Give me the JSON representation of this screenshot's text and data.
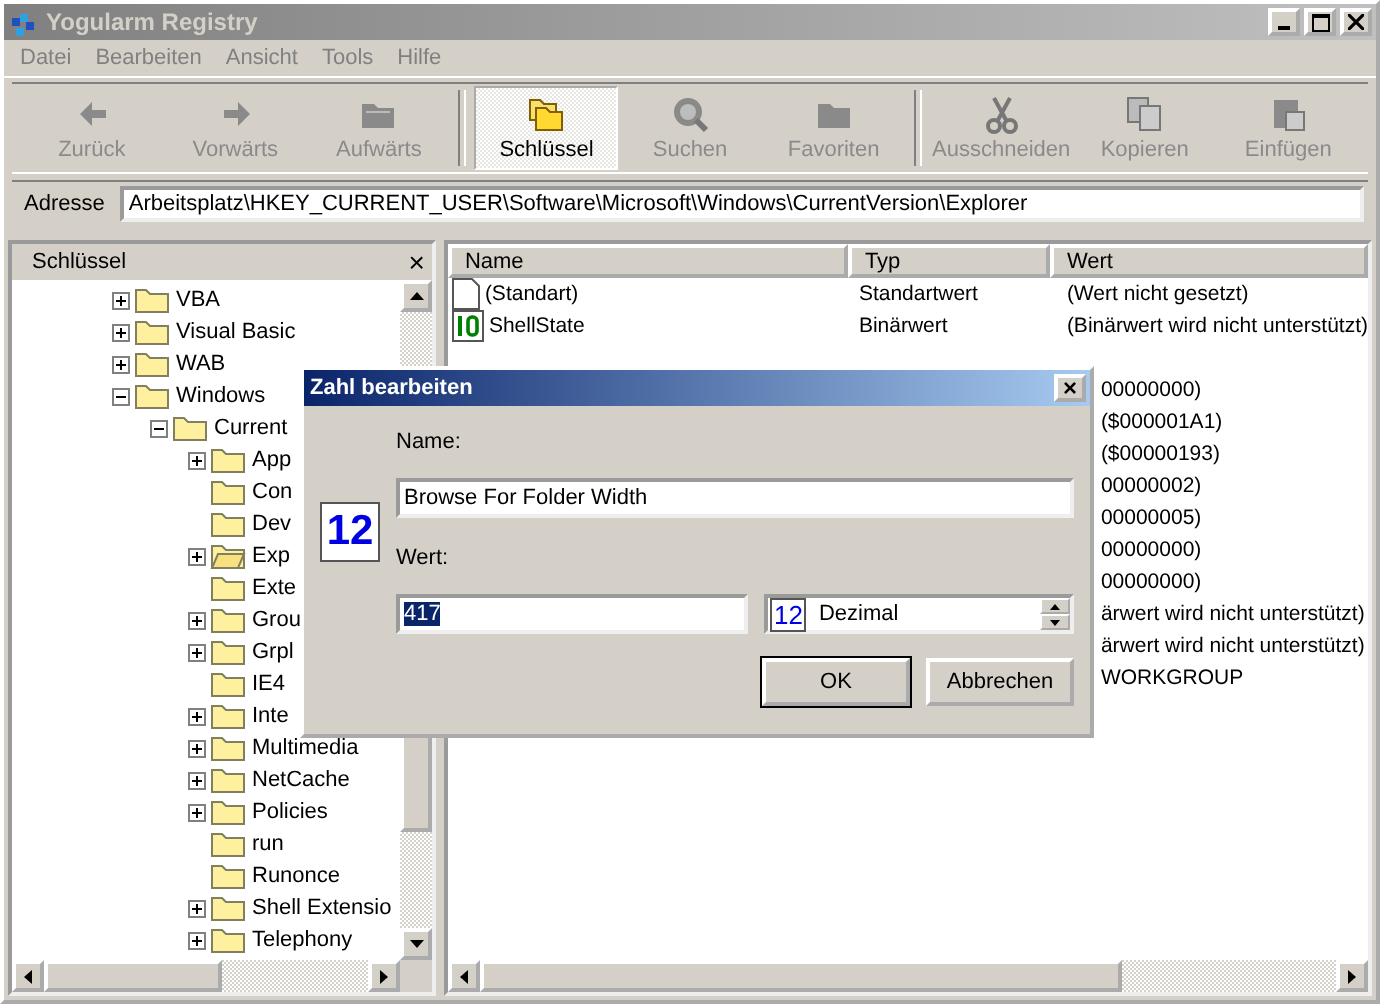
{
  "window": {
    "title": "Yogularm Registry"
  },
  "menu": [
    "Datei",
    "Bearbeiten",
    "Ansicht",
    "Tools",
    "Hilfe"
  ],
  "toolbar": [
    {
      "kind": "back",
      "label": "Zurück",
      "selected": false,
      "disabled": true
    },
    {
      "kind": "forward",
      "label": "Vorwärts",
      "selected": false,
      "disabled": true
    },
    {
      "kind": "up",
      "label": "Aufwärts",
      "selected": false,
      "disabled": true
    },
    {
      "kind": "keys",
      "label": "Schlüssel",
      "selected": true,
      "disabled": false
    },
    {
      "kind": "search",
      "label": "Suchen",
      "selected": false,
      "disabled": true
    },
    {
      "kind": "favorites",
      "label": "Favoriten",
      "selected": false,
      "disabled": true
    },
    {
      "kind": "cut",
      "label": "Ausschneiden",
      "selected": false,
      "disabled": true
    },
    {
      "kind": "copy",
      "label": "Kopieren",
      "selected": false,
      "disabled": true
    },
    {
      "kind": "paste",
      "label": "Einfügen",
      "selected": false,
      "disabled": true
    }
  ],
  "address": {
    "label": "Adresse",
    "value": "Arbeitsplatz\\HKEY_CURRENT_USER\\Software\\Microsoft\\Windows\\CurrentVersion\\Explorer"
  },
  "tree_panel": {
    "title": "Schlüssel",
    "close": "×"
  },
  "tree": [
    {
      "label": "VBA",
      "kind": "node",
      "expanded": false
    },
    {
      "label": "Visual Basic",
      "kind": "node",
      "expanded": false
    },
    {
      "label": "WAB",
      "kind": "node",
      "expanded": false
    },
    {
      "label": "Windows",
      "kind": "node",
      "expanded": true,
      "children": [
        {
          "label": "Current",
          "kind": "node",
          "expanded": true,
          "children": [
            {
              "label": "App",
              "kind": "node",
              "expanded": false
            },
            {
              "label": "Con",
              "kind": "leaf"
            },
            {
              "label": "Dev",
              "kind": "leaf"
            },
            {
              "label": "Exp",
              "kind": "node",
              "expanded": false,
              "selected": true
            },
            {
              "label": "Exte",
              "kind": "leaf"
            },
            {
              "label": "Grou",
              "kind": "node",
              "expanded": false
            },
            {
              "label": "Grpl",
              "kind": "node",
              "expanded": false
            },
            {
              "label": "IE4",
              "kind": "leaf"
            },
            {
              "label": "Inte",
              "kind": "node",
              "expanded": false
            },
            {
              "label": "Multimedia",
              "kind": "node",
              "expanded": false
            },
            {
              "label": "NetCache",
              "kind": "node",
              "expanded": false
            },
            {
              "label": "Policies",
              "kind": "node",
              "expanded": false
            },
            {
              "label": "run",
              "kind": "leaf"
            },
            {
              "label": "Runonce",
              "kind": "leaf"
            },
            {
              "label": "Shell Extensio",
              "kind": "node",
              "expanded": false
            },
            {
              "label": "Telephony",
              "kind": "node",
              "expanded": false
            }
          ]
        }
      ]
    }
  ],
  "table": {
    "columns": [
      "Name",
      "Typ",
      "Wert"
    ],
    "rows": [
      {
        "kind": "string",
        "name": "(Standart)",
        "type": "Standartwert",
        "value": "(Wert nicht gesetzt)"
      },
      {
        "kind": "binary",
        "name": "ShellState",
        "type": "Binärwert",
        "value": "(Binärwert wird nicht unterstützt)"
      },
      {
        "kind": "covered"
      },
      {
        "kind": "hidden",
        "value": "00000000)"
      },
      {
        "kind": "hidden",
        "value": "($000001A1)"
      },
      {
        "kind": "hidden",
        "value": "($00000193)"
      },
      {
        "kind": "hidden",
        "value": "00000002)"
      },
      {
        "kind": "hidden",
        "value": "00000005)"
      },
      {
        "kind": "hidden",
        "value": "00000000)"
      },
      {
        "kind": "hidden",
        "value": "00000000)"
      },
      {
        "kind": "hidden",
        "value": "ärwert wird nicht unterstützt)"
      },
      {
        "kind": "hidden",
        "value": "ärwert wird nicht unterstützt)"
      },
      {
        "kind": "hidden",
        "value": "WORKGROUP"
      }
    ]
  },
  "dialog": {
    "title": "Zahl bearbeiten",
    "close": "×",
    "icon_text": "12",
    "name_label": "Name:",
    "name_value": "Browse For Folder Width",
    "value_label": "Wert:",
    "value": "417",
    "base_icon_text": "12",
    "base": "Dezimal",
    "buttons": [
      "OK",
      "Abbrechen"
    ]
  }
}
